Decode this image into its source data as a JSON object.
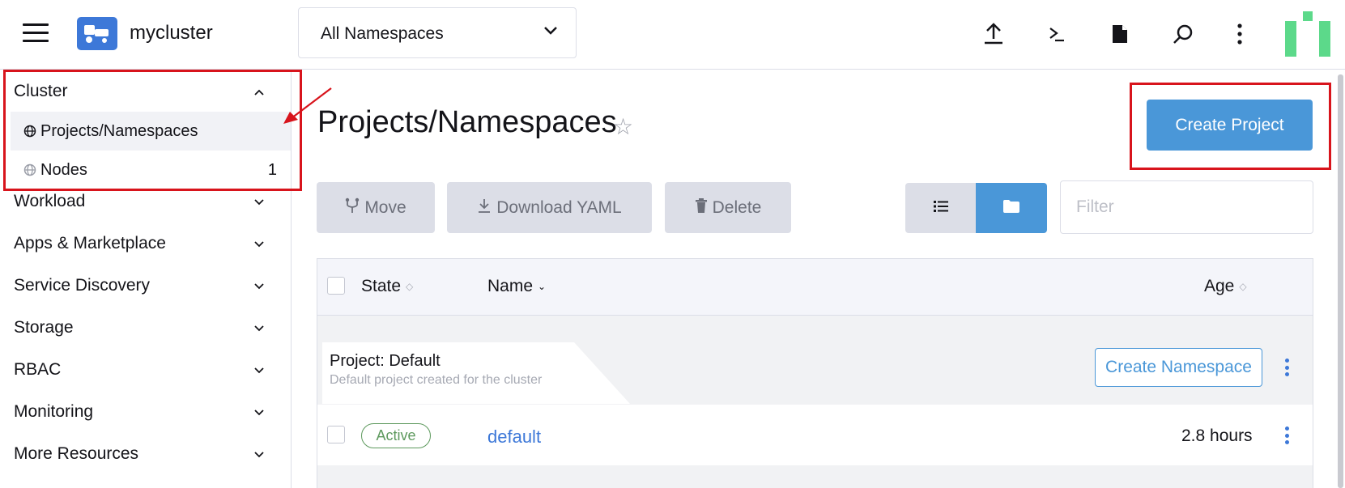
{
  "header": {
    "cluster_name": "mycluster",
    "namespace_filter": "All Namespaces",
    "icons": [
      "menu-icon",
      "cluster-logo-icon",
      "chevron-down-icon",
      "import-yaml-icon",
      "kubectl-shell-icon",
      "kubeconfig-file-icon",
      "search-icon",
      "more-vertical-icon"
    ]
  },
  "sidebar": {
    "cluster_group": {
      "label": "Cluster",
      "items": [
        {
          "label": "Projects/Namespaces",
          "count": ""
        },
        {
          "label": "Nodes",
          "count": "1"
        }
      ]
    },
    "groups": [
      {
        "label": "Workload"
      },
      {
        "label": "Apps & Marketplace"
      },
      {
        "label": "Service Discovery"
      },
      {
        "label": "Storage"
      },
      {
        "label": "RBAC"
      },
      {
        "label": "Monitoring"
      },
      {
        "label": "More Resources"
      }
    ]
  },
  "main": {
    "title": "Projects/Namespaces",
    "create_button": "Create Project",
    "toolbar": {
      "move": "Move",
      "download_yaml": "Download YAML",
      "delete": "Delete"
    },
    "filter_placeholder": "Filter",
    "table": {
      "columns": [
        "State",
        "Name",
        "Age"
      ],
      "group": {
        "title": "Project: Default",
        "description": "Default project created for the cluster",
        "create_namespace": "Create Namespace"
      },
      "rows": [
        {
          "state": "Active",
          "name": "default",
          "age": "2.8 hours"
        }
      ]
    }
  },
  "colors": {
    "accent": "#4a97d8",
    "link": "#3d78d8",
    "highlight": "#d8141c",
    "active_badge": "#5d995d",
    "logo_bg": "#3d78d8"
  }
}
